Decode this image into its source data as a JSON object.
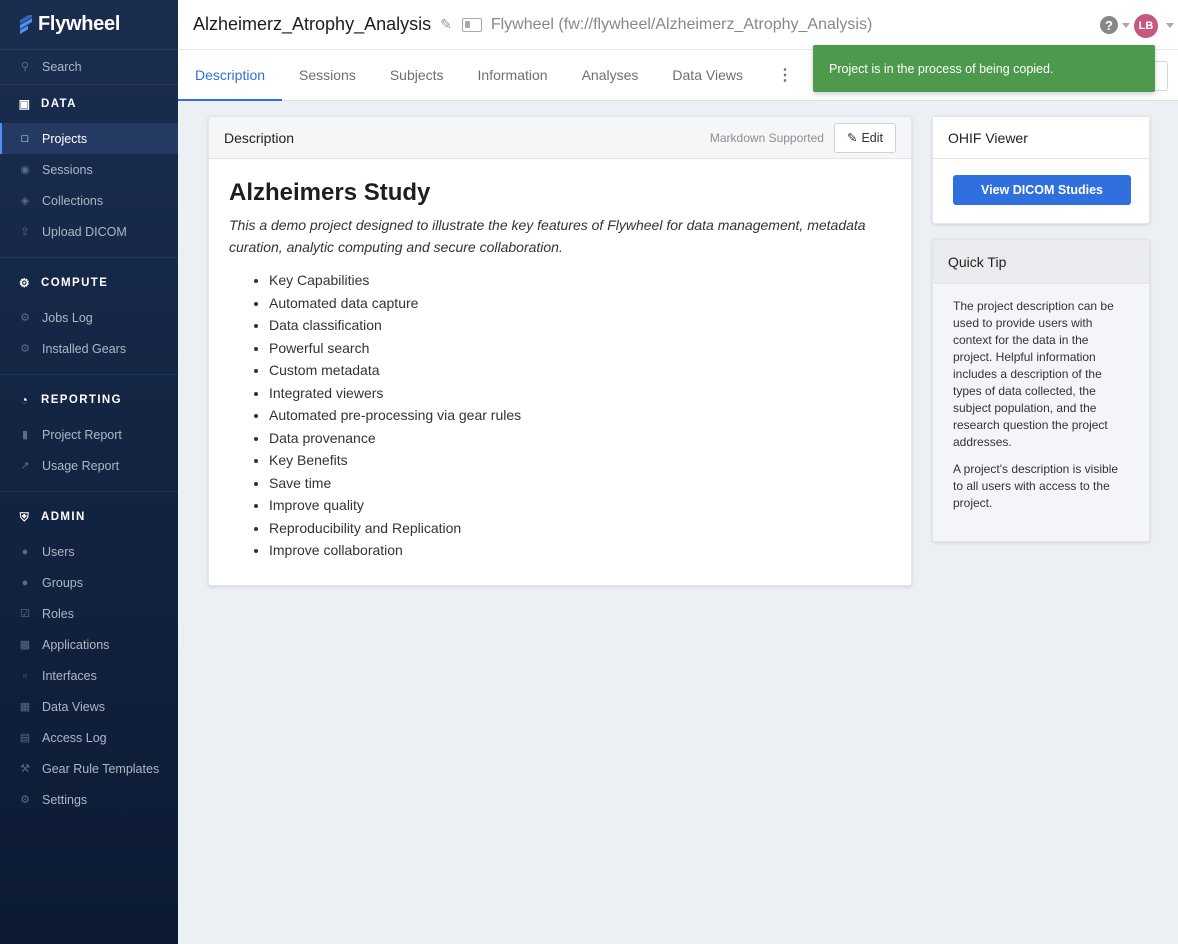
{
  "app": {
    "name": "Flywheel"
  },
  "sidebar": {
    "search": "Search",
    "sections": {
      "data": "DATA",
      "compute": "COMPUTE",
      "reporting": "REPORTING",
      "admin": "ADMIN"
    },
    "data_items": [
      "Projects",
      "Sessions",
      "Collections",
      "Upload DICOM"
    ],
    "compute_items": [
      "Jobs Log",
      "Installed Gears"
    ],
    "reporting_items": [
      "Project Report",
      "Usage Report"
    ],
    "admin_items": [
      "Users",
      "Groups",
      "Roles",
      "Applications",
      "Interfaces",
      "Data Views",
      "Access Log",
      "Gear Rule Templates",
      "Settings"
    ]
  },
  "header": {
    "title": "Alzheimerz_Atrophy_Analysis",
    "path": "Flywheel (fw://flywheel/Alzheimerz_Atrophy_Analysis)",
    "help": "?",
    "avatar": "LB"
  },
  "tabs": [
    "Description",
    "Sessions",
    "Subjects",
    "Information",
    "Analyses",
    "Data Views"
  ],
  "toast": "Project is in the process of being copied.",
  "description": {
    "header": "Description",
    "markdown_label": "Markdown Supported",
    "edit_label": "Edit",
    "title": "Alzheimers Study",
    "subtitle": "This a demo project designed to illustrate the key features of Flywheel for data management, metadata curation, analytic computing and secure collaboration.",
    "items": [
      "Key Capabilities",
      "Automated data capture",
      "Data classification",
      "Powerful search",
      "Custom metadata",
      "Integrated viewers",
      "Automated pre-processing via gear rules",
      "Data provenance",
      "Key Benefits",
      "Save time",
      "Improve quality",
      "Reproducibility and Replication",
      "Improve collaboration"
    ]
  },
  "ohif": {
    "header": "OHIF Viewer",
    "button": "View DICOM Studies"
  },
  "tip": {
    "header": "Quick Tip",
    "p1": "The project description can be used to provide users with context for the data in the project. Helpful information includes a description of the types of data collected, the subject population, and the research question the project addresses.",
    "p2": "A project's description is visible to all users with access to the project."
  },
  "colors": {
    "accent": "#2f6fde",
    "toast": "#4d9a4d",
    "sidebar": "#122341",
    "avatar": "#c6577e"
  }
}
